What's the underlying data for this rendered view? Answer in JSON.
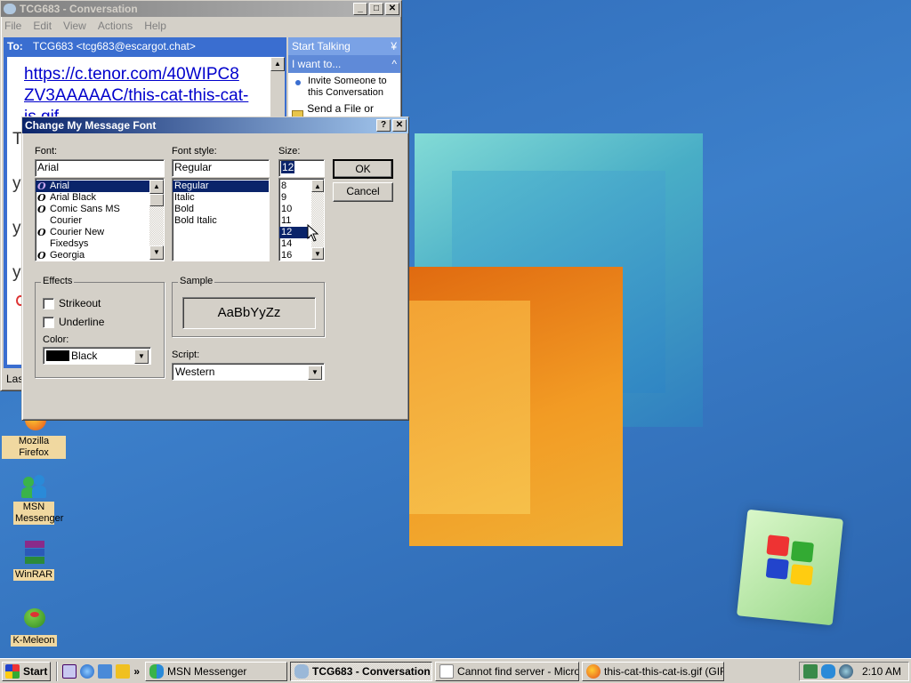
{
  "conversation_window": {
    "title": "TCG683 - Conversation",
    "menu": [
      "File",
      "Edit",
      "View",
      "Actions",
      "Help"
    ],
    "to_label": "To:",
    "to_value": "TCG683 <tcg683@escargot.chat>",
    "message_link": "https://c.tenor.com/40WIPC8ZV3AAAAAC/this-cat-this-cat-is.gif",
    "message_link_lines": [
      "https://c.tenor.com/40WIPC8",
      "ZV3AAAAAC/this-cat-this-cat-",
      "is.gif"
    ],
    "partial_chars": [
      "T",
      "y",
      "y",
      "y"
    ],
    "status_partial": "Las",
    "panel": {
      "start_talking": "Start Talking",
      "i_want_to": "I want to...",
      "invite": "Invite Someone to this Conversation",
      "send_file": "Send a File or Photo"
    }
  },
  "font_dialog": {
    "title": "Change My Message Font",
    "help_btn": "?",
    "close_btn": "✕",
    "font_label": "Font:",
    "font_value": "Arial",
    "fonts": [
      {
        "name": "Arial",
        "tt": true,
        "selected": true
      },
      {
        "name": "Arial Black",
        "tt": true
      },
      {
        "name": "Comic Sans MS",
        "tt": true
      },
      {
        "name": "Courier",
        "tt": false
      },
      {
        "name": "Courier New",
        "tt": true
      },
      {
        "name": "Fixedsys",
        "tt": false
      },
      {
        "name": "Georgia",
        "tt": true
      }
    ],
    "style_label": "Font style:",
    "style_value": "Regular",
    "styles": [
      "Regular",
      "Italic",
      "Bold",
      "Bold Italic"
    ],
    "size_label": "Size:",
    "size_value": "12",
    "sizes": [
      "8",
      "9",
      "10",
      "11",
      "12",
      "14",
      "16"
    ],
    "selected_size": "12",
    "ok": "OK",
    "cancel": "Cancel",
    "effects_label": "Effects",
    "strikeout": "Strikeout",
    "underline": "Underline",
    "color_label": "Color:",
    "color_value": "Black",
    "color_swatch": "#000000",
    "sample_label": "Sample",
    "sample_text": "AaBbYyZz",
    "script_label": "Script:",
    "script_value": "Western"
  },
  "desktop_icons": [
    {
      "label": "Mozilla Firefox",
      "icon": "firefox-icon"
    },
    {
      "label": "MSN Messenger",
      "icon": "msn-messenger-icon"
    },
    {
      "label": "WinRAR",
      "icon": "winrar-icon"
    },
    {
      "label": "K-Meleon",
      "icon": "k-meleon-icon"
    }
  ],
  "taskbar": {
    "start": "Start",
    "tasks": [
      {
        "label": "MSN Messenger",
        "icon": "msn-messenger-icon",
        "pressed": false
      },
      {
        "label": "TCG683 - Conversation",
        "icon": "conversation-icon",
        "pressed": true
      },
      {
        "label": "Cannot find server - Micros...",
        "icon": "ie-icon",
        "pressed": false
      },
      {
        "label": "this-cat-this-cat-is.gif (GIF I...",
        "icon": "firefox-icon",
        "pressed": false
      }
    ],
    "clock": "2:10 AM"
  },
  "colors": {
    "title_active": "#0a246a",
    "selection": "#0a246a",
    "desktop": "#3a78c4",
    "link": "#0000cc"
  }
}
